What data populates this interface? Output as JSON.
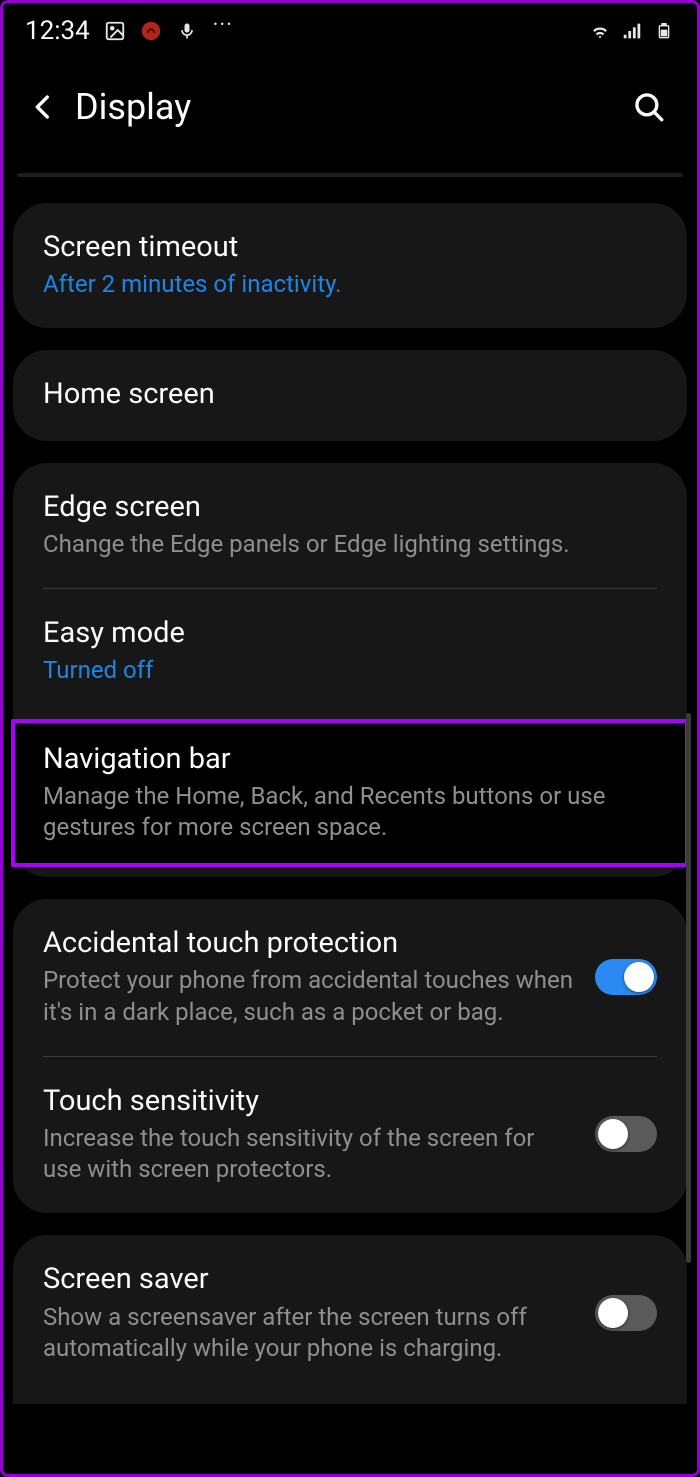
{
  "status": {
    "time": "12:34"
  },
  "header": {
    "title": "Display"
  },
  "group1": {
    "screen_timeout": {
      "title": "Screen timeout",
      "sub": "After 2 minutes of inactivity."
    }
  },
  "group2": {
    "home_screen": {
      "title": "Home screen"
    }
  },
  "group3": {
    "edge_screen": {
      "title": "Edge screen",
      "sub": "Change the Edge panels or Edge lighting settings."
    },
    "easy_mode": {
      "title": "Easy mode",
      "sub": "Turned off"
    },
    "nav_bar": {
      "title": "Navigation bar",
      "sub": "Manage the Home, Back, and Recents buttons or use gestures for more screen space."
    }
  },
  "group4": {
    "accidental": {
      "title": "Accidental touch protection",
      "sub": "Protect your phone from accidental touches when it's in a dark place, such as a pocket or bag.",
      "toggle": true
    },
    "touch_sens": {
      "title": "Touch sensitivity",
      "sub": "Increase the touch sensitivity of the screen for use with screen protectors.",
      "toggle": false
    }
  },
  "group5": {
    "screen_saver": {
      "title": "Screen saver",
      "sub": "Show a screensaver after the screen turns off automatically while your phone is charging.",
      "toggle": false
    }
  }
}
